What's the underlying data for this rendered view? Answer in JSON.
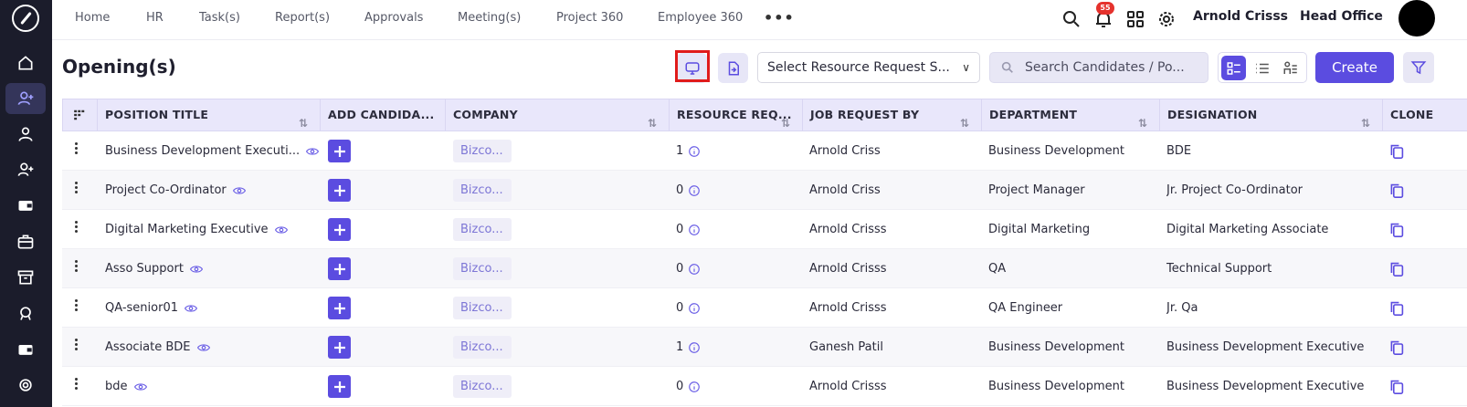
{
  "sidebar": {
    "items": [
      {
        "icon": "home-icon"
      },
      {
        "icon": "add-user-icon",
        "active": true
      },
      {
        "icon": "user-icon"
      },
      {
        "icon": "user-plus-icon"
      },
      {
        "icon": "wallet-icon"
      },
      {
        "icon": "briefcase-icon"
      },
      {
        "icon": "archive-icon"
      },
      {
        "icon": "badge-icon"
      },
      {
        "icon": "card-icon"
      },
      {
        "icon": "settings-icon"
      }
    ]
  },
  "topnav": {
    "items": [
      "Home",
      "HR",
      "Task(s)",
      "Report(s)",
      "Approvals",
      "Meeting(s)",
      "Project 360",
      "Employee 360"
    ],
    "more": "•••",
    "notification_count": "55",
    "user_name": "Arnold Crisss",
    "office": "Head Office"
  },
  "toolbar": {
    "title": "Opening(s)",
    "select_placeholder": "Select Resource Request S...",
    "search_placeholder": "Search Candidates / Po...",
    "create_label": "Create"
  },
  "table": {
    "headers": [
      "POSITION TITLE",
      "ADD CANDIDA...",
      "COMPANY",
      "RESOURCE REQ...",
      "JOB REQUEST BY",
      "DEPARTMENT",
      "DESIGNATION",
      "CLONE"
    ],
    "rows": [
      {
        "title": "Business Development Executi...",
        "company": "Bizco...",
        "resource": "1",
        "requested_by": "Arnold Criss",
        "department": "Business Development",
        "designation": "BDE"
      },
      {
        "title": "Project Co-Ordinator",
        "company": "Bizco...",
        "resource": "0",
        "requested_by": "Arnold Criss",
        "department": "Project Manager",
        "designation": "Jr. Project Co-Ordinator"
      },
      {
        "title": "Digital Marketing Executive",
        "company": "Bizco...",
        "resource": "0",
        "requested_by": "Arnold Crisss",
        "department": "Digital Marketing",
        "designation": "Digital Marketing Associate"
      },
      {
        "title": "Asso Support",
        "company": "Bizco...",
        "resource": "0",
        "requested_by": "Arnold Crisss",
        "department": "QA",
        "designation": "Technical Support"
      },
      {
        "title": "QA-senior01",
        "company": "Bizco...",
        "resource": "0",
        "requested_by": "Arnold Crisss",
        "department": "QA Engineer",
        "designation": "Jr. Qa"
      },
      {
        "title": "Associate BDE",
        "company": "Bizco...",
        "resource": "1",
        "requested_by": "Ganesh Patil",
        "department": "Business Development",
        "designation": "Business Development Executive"
      },
      {
        "title": "bde",
        "company": "Bizco...",
        "resource": "0",
        "requested_by": "Arnold Crisss",
        "department": "Business Development",
        "designation": "Business Development Executive"
      }
    ]
  },
  "colors": {
    "accent": "#5b4ce0",
    "sidebar": "#1b1c2b",
    "header_bg": "#e9e7fb",
    "highlight": "#e01b1b"
  }
}
